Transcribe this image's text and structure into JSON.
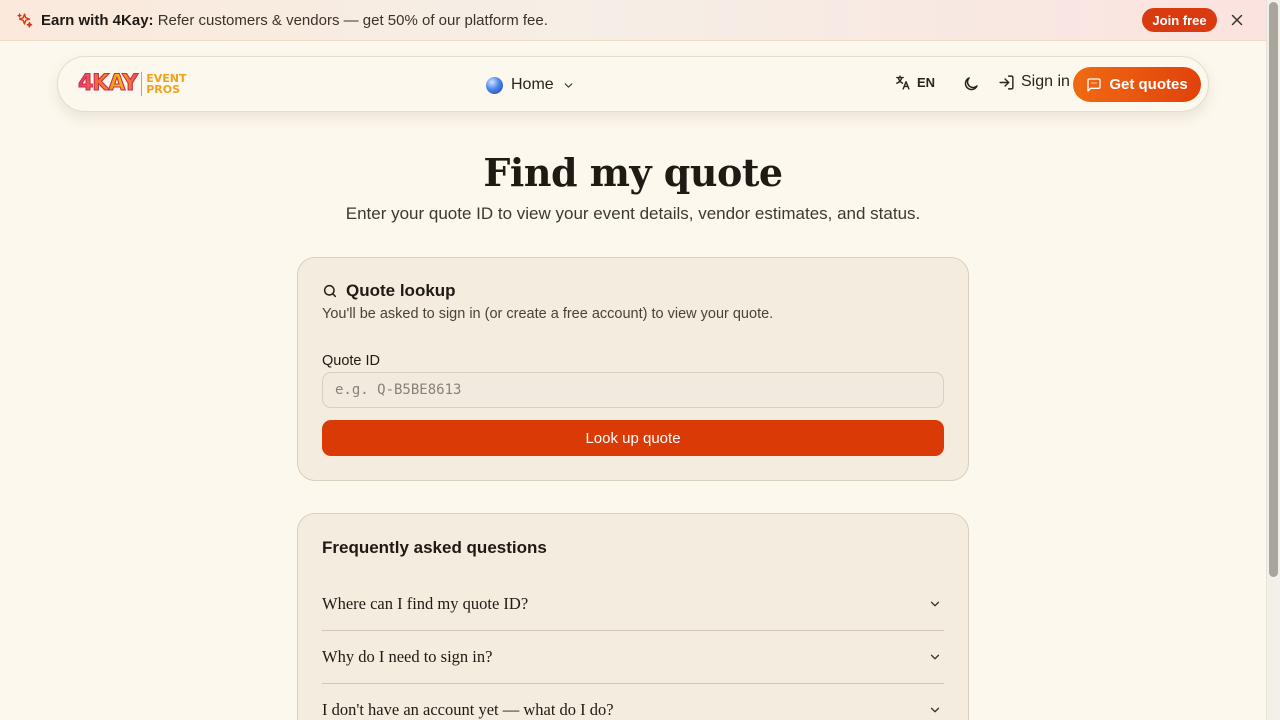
{
  "banner": {
    "brand": "Earn with 4Kay:",
    "message": "Refer customers & vendors — get 50% of our platform fee.",
    "join_label": "Join free",
    "icon": "sparkles-icon",
    "accent_color": "#d93a10"
  },
  "nav": {
    "logo": {
      "mark": "4KAY",
      "line1": "EVENT",
      "line2": "PROS"
    },
    "home_label": "Home",
    "language": "EN",
    "signin_label": "Sign in",
    "cta_label": "Get quotes"
  },
  "page": {
    "title": "Find my quote",
    "subtitle": "Enter your quote ID to view your event details, vendor estimates, and status."
  },
  "lookup": {
    "heading": "Quote lookup",
    "description": "You'll be asked to sign in (or create a free account) to view your quote.",
    "field_label": "Quote ID",
    "placeholder": "e.g. Q-B5BE8613",
    "value": "",
    "submit_label": "Look up quote",
    "button_color": "#d93a06"
  },
  "faq": {
    "title": "Frequently asked questions",
    "items": [
      {
        "question": "Where can I find my quote ID?"
      },
      {
        "question": "Why do I need to sign in?"
      },
      {
        "question": "I don't have an account yet — what do I do?"
      }
    ]
  }
}
